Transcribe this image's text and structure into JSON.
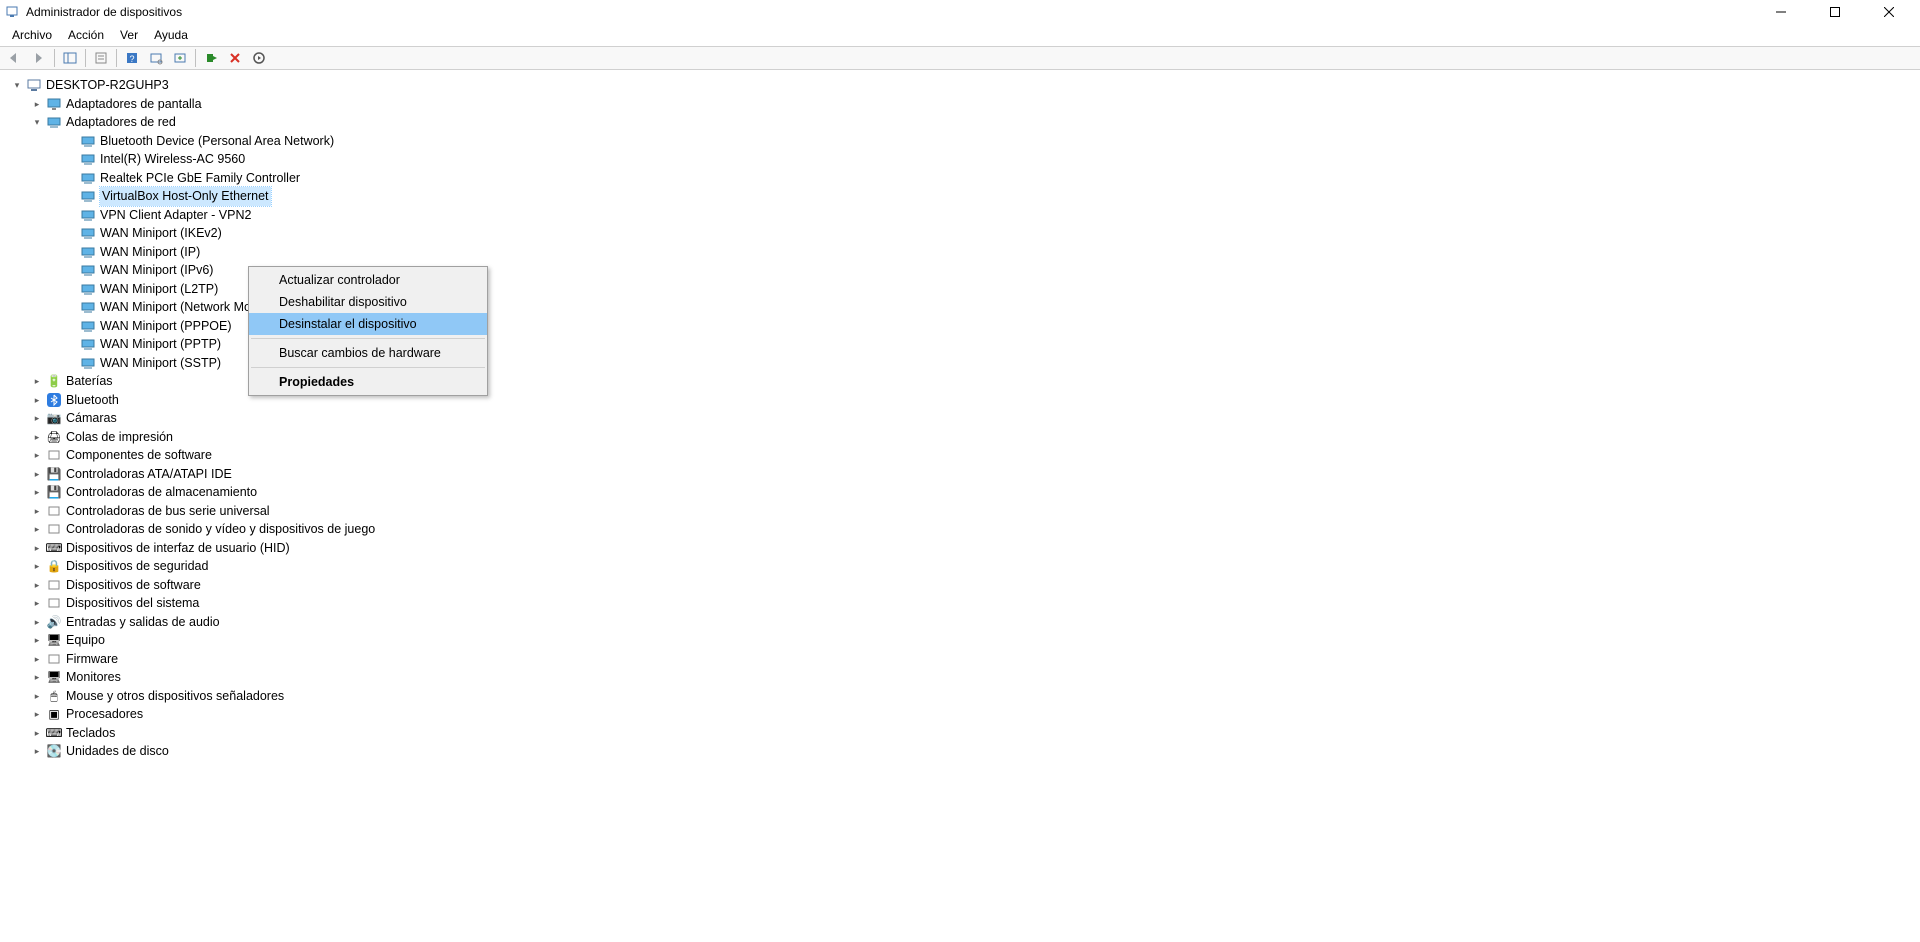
{
  "window": {
    "title": "Administrador de dispositivos"
  },
  "menubar": {
    "items": [
      "Archivo",
      "Acción",
      "Ver",
      "Ayuda"
    ]
  },
  "tree": {
    "root": "DESKTOP-R2GUHP3",
    "display_adapters": "Adaptadores de pantalla",
    "network_adapters": "Adaptadores de red",
    "net_children": [
      "Bluetooth Device (Personal Area Network)",
      "Intel(R) Wireless-AC 9560",
      "Realtek PCIe GbE Family Controller",
      "VirtualBox Host-Only Ethernet",
      "VPN Client Adapter - VPN2",
      "WAN Miniport (IKEv2)",
      "WAN Miniport (IP)",
      "WAN Miniport (IPv6)",
      "WAN Miniport (L2TP)",
      "WAN Miniport (Network Moni",
      "WAN Miniport (PPPOE)",
      "WAN Miniport (PPTP)",
      "WAN Miniport (SSTP)"
    ],
    "categories": [
      "Baterías",
      "Bluetooth",
      "Cámaras",
      "Colas de impresión",
      "Componentes de software",
      "Controladoras ATA/ATAPI IDE",
      "Controladoras de almacenamiento",
      "Controladoras de bus serie universal",
      "Controladoras de sonido y vídeo y dispositivos de juego",
      "Dispositivos de interfaz de usuario (HID)",
      "Dispositivos de seguridad",
      "Dispositivos de software",
      "Dispositivos del sistema",
      "Entradas y salidas de audio",
      "Equipo",
      "Firmware",
      "Monitores",
      "Mouse y otros dispositivos señaladores",
      "Procesadores",
      "Teclados",
      "Unidades de disco"
    ],
    "selected_net_index": 3
  },
  "context_menu": {
    "items": [
      "Actualizar controlador",
      "Deshabilitar dispositivo",
      "Desinstalar el dispositivo",
      "Buscar cambios de hardware",
      "Propiedades"
    ],
    "highlighted_index": 2,
    "bold_index": 4
  },
  "category_icons": {
    "0": "🔋",
    "2": "📷",
    "3": "🖨",
    "5": "💾",
    "6": "💾",
    "9": "⌨",
    "10": "🔒",
    "13": "🔊",
    "14": "🖥",
    "16": "🖥",
    "17": "🖱",
    "18": "▣",
    "19": "⌨",
    "20": "💽"
  }
}
